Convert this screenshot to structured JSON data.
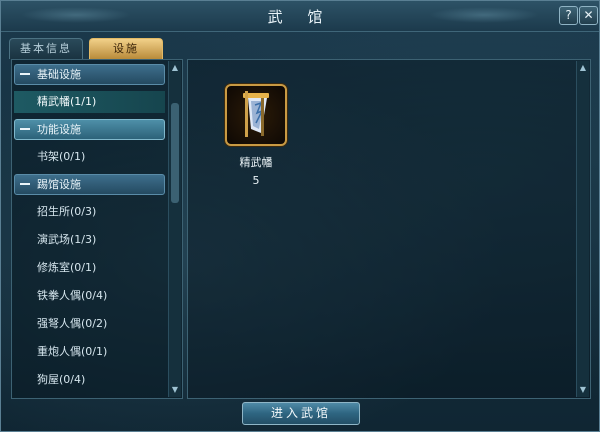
{
  "window": {
    "title": "武 馆",
    "help_label": "?",
    "close_label": "✕"
  },
  "tabs": [
    {
      "label": "基本信息"
    },
    {
      "label": "设施"
    }
  ],
  "sidebar": {
    "categories": [
      {
        "label": "基础设施",
        "items": [
          {
            "label": "精武幡(1/1)"
          }
        ]
      },
      {
        "label": "功能设施",
        "items": [
          {
            "label": "书架(0/1)"
          }
        ]
      },
      {
        "label": "踢馆设施",
        "items": [
          {
            "label": "招生所(0/3)"
          },
          {
            "label": "演武场(1/3)"
          },
          {
            "label": "修炼室(0/1)"
          },
          {
            "label": "铁拳人偶(0/4)"
          },
          {
            "label": "强弩人偶(0/2)"
          },
          {
            "label": "重炮人偶(0/1)"
          },
          {
            "label": "狗屋(0/4)"
          }
        ]
      }
    ]
  },
  "facility": {
    "name": "精武幡",
    "count": "5",
    "icon": "banner-icon"
  },
  "enter_button": {
    "label": "进入武馆"
  }
}
